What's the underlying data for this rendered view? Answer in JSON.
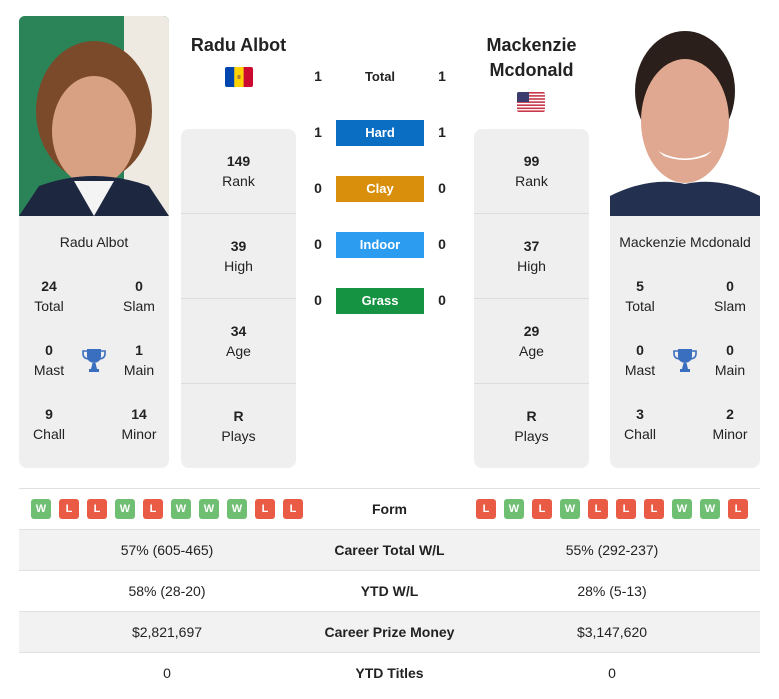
{
  "colors": {
    "hard": "#0a6fc2",
    "clay": "#d98f0b",
    "indoor": "#2c9cf0",
    "grass": "#159343",
    "win": "#6fbf73",
    "loss": "#ea5b45",
    "trophy": "#3a6fbf"
  },
  "player1": {
    "name": "Radu Albot",
    "flag": "moldova-flag",
    "photo_alt": "Radu Albot photo",
    "rank": {
      "value": "149",
      "label": "Rank"
    },
    "high": {
      "value": "39",
      "label": "High"
    },
    "age": {
      "value": "34",
      "label": "Age"
    },
    "plays": {
      "value": "R",
      "label": "Plays"
    },
    "titles": {
      "total": {
        "value": "24",
        "label": "Total"
      },
      "slam": {
        "value": "0",
        "label": "Slam"
      },
      "mast": {
        "value": "0",
        "label": "Mast"
      },
      "main": {
        "value": "1",
        "label": "Main"
      },
      "chall": {
        "value": "9",
        "label": "Chall"
      },
      "minor": {
        "value": "14",
        "label": "Minor"
      }
    },
    "form": [
      "W",
      "L",
      "L",
      "W",
      "L",
      "W",
      "W",
      "W",
      "L",
      "L"
    ]
  },
  "player2": {
    "name": "Mackenzie Mcdonald",
    "flag": "usa-flag",
    "photo_alt": "Mackenzie Mcdonald photo",
    "rank": {
      "value": "99",
      "label": "Rank"
    },
    "high": {
      "value": "37",
      "label": "High"
    },
    "age": {
      "value": "29",
      "label": "Age"
    },
    "plays": {
      "value": "R",
      "label": "Plays"
    },
    "titles": {
      "total": {
        "value": "5",
        "label": "Total"
      },
      "slam": {
        "value": "0",
        "label": "Slam"
      },
      "mast": {
        "value": "0",
        "label": "Mast"
      },
      "main": {
        "value": "0",
        "label": "Main"
      },
      "chall": {
        "value": "3",
        "label": "Chall"
      },
      "minor": {
        "value": "2",
        "label": "Minor"
      }
    },
    "form": [
      "L",
      "W",
      "L",
      "W",
      "L",
      "L",
      "L",
      "W",
      "W",
      "L"
    ]
  },
  "h2h": [
    {
      "label": "Total",
      "left": "1",
      "right": "1",
      "surface": "total"
    },
    {
      "label": "Hard",
      "left": "1",
      "right": "1",
      "surface": "hard"
    },
    {
      "label": "Clay",
      "left": "0",
      "right": "0",
      "surface": "clay"
    },
    {
      "label": "Indoor",
      "left": "0",
      "right": "0",
      "surface": "indoor"
    },
    {
      "label": "Grass",
      "left": "0",
      "right": "0",
      "surface": "grass"
    }
  ],
  "comparison": {
    "form_label": "Form",
    "rows": [
      {
        "label": "Career Total W/L",
        "left": "57% (605-465)",
        "right": "55% (292-237)"
      },
      {
        "label": "YTD W/L",
        "left": "58% (28-20)",
        "right": "28% (5-13)"
      },
      {
        "label": "Career Prize Money",
        "left": "$2,821,697",
        "right": "$3,147,620"
      },
      {
        "label": "YTD Titles",
        "left": "0",
        "right": "0"
      }
    ]
  }
}
